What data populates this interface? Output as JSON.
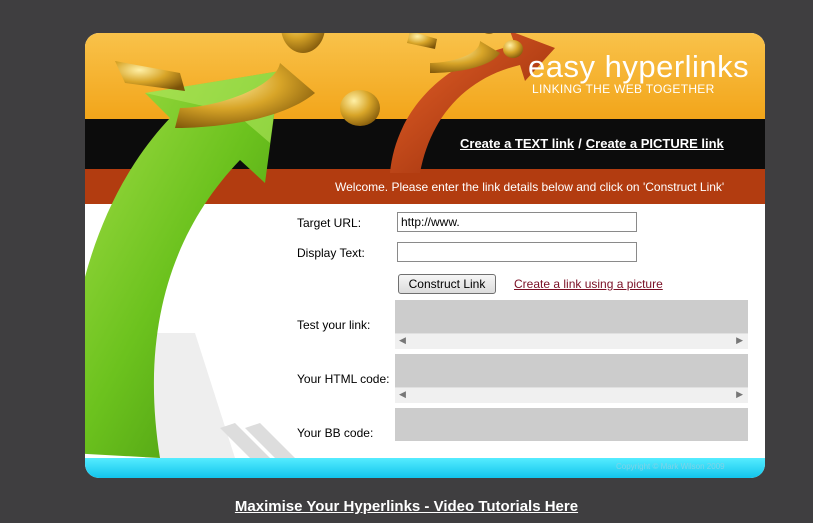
{
  "logo": {
    "title": "easy hyperlinks",
    "tagline": "LINKING THE WEB TOGETHER"
  },
  "nav": {
    "text_link": "Create a TEXT link",
    "separator": "/",
    "picture_link": "Create a PICTURE link"
  },
  "welcome": "Welcome. Please enter the link details below and click on 'Construct Link'",
  "form": {
    "target_url_label": "Target URL:",
    "target_url_value": "http://www.",
    "display_text_label": "Display Text:",
    "display_text_value": "",
    "construct_button": "Construct Link",
    "picture_link": "Create a link using a picture",
    "test_label": "Test your link:",
    "html_label": "Your HTML code:",
    "bb_label": "Your BB code:"
  },
  "footer": {
    "copyright": "Copyright © Mark Wilson 2009"
  },
  "bottom_link": "Maximise Your Hyperlinks - Video Tutorials Here",
  "colors": {
    "page_bg": "#3f3e40",
    "header": "#f5b225",
    "nav_bar": "#0c0c0c",
    "welcome_bar": "#b23c10",
    "footer": "#1fd3f2",
    "green_arrow": "#6cc21e",
    "red_arrow": "#c0380c",
    "gold_figure": "#d8a528"
  },
  "icons": {
    "scroll_left": "scroll-left-arrow-icon",
    "scroll_right": "scroll-right-arrow-icon"
  }
}
